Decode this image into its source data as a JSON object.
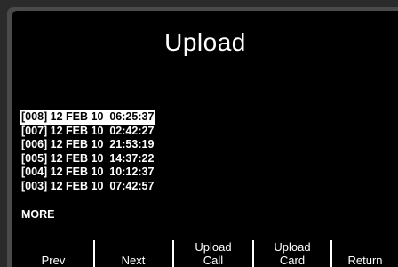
{
  "screen": {
    "title": "Upload"
  },
  "records": [
    {
      "label": "[008] 12 FEB 10  06:25:37",
      "selected": true
    },
    {
      "label": "[007] 12 FEB 10  02:42:27",
      "selected": false
    },
    {
      "label": "[006] 12 FEB 10  21:53:19",
      "selected": false
    },
    {
      "label": "[005] 12 FEB 10  14:37:22",
      "selected": false
    },
    {
      "label": "[004] 12 FEB 10  10:12:37",
      "selected": false
    },
    {
      "label": "[003] 12 FEB 10  07:42:57",
      "selected": false
    }
  ],
  "more_label": "MORE",
  "softkeys": {
    "prev": "Prev",
    "next": "Next",
    "upload_call_line1": "Upload",
    "upload_call_line2": "Call",
    "upload_card_line1": "Upload",
    "upload_card_line2": "Card",
    "return": "Return"
  },
  "colors": {
    "screen_background": "#000000",
    "text": "#ffffff",
    "selection_background": "#ffffff",
    "selection_text": "#000000",
    "bezel": "#2b2b2b"
  }
}
